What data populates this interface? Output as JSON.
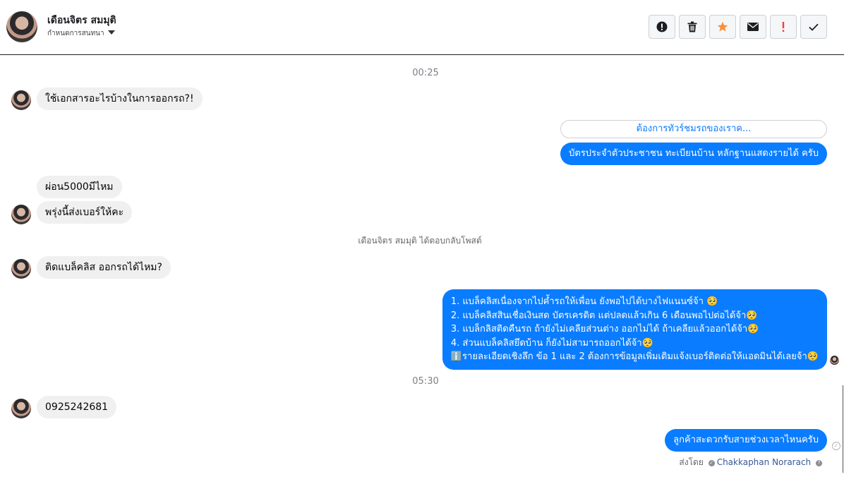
{
  "header": {
    "name": "เดือนจิตร สมมุติ",
    "subtitle": "กำหนดการสนทนา"
  },
  "toolbar": {
    "buttons": [
      {
        "icon": "info-circle-icon"
      },
      {
        "icon": "trash-icon"
      },
      {
        "icon": "star-icon",
        "color": "#f7923b"
      },
      {
        "icon": "envelope-icon"
      },
      {
        "icon": "exclamation-icon",
        "color": "#fa383e"
      },
      {
        "icon": "check-icon"
      }
    ]
  },
  "thread": {
    "time1": "00:25",
    "msg1": "ใช้เอกสารอะไรบ้างในการออกรถ?!",
    "quick_reply": "ต้องการทัวร์ชมรถของเราค...",
    "reply1": "บัตรประจำตัวประชาชน ทะเบียนบ้าน หลักฐานแสดงรายได้ ครับ",
    "msg2": "ผ่อน5000มีไหม",
    "msg3": "พรุ่งนี้ส่งเบอร์ให้คะ",
    "system_note": "เดือนจิตร สมมุติ ได้ตอบกลับโพสต์",
    "msg4": "ติดแบล็คลิส ออกรถได้ไหม?",
    "reply2": "1. แบล็คลิสเนื่องจากไปค้ำรถให้เพื่อน ยังพอไปได้บางไฟแนนซ์จ้า 🥺\n2. แบล็คลิสสินเชื่อเงินสด บัตรเครดิต แต่ปลดแล้วเกิน 6 เดือนพอไปต่อได้จ้า🥺\n3. แบล็กลิสติดคืนรถ ถ้ายังไม่เคลียส่วนต่าง ออกไม่ได้ ถ้าเคลียแล้วออกได้จ้า🥺\n4. ส่วนแบล็คลิสยึดบ้าน ก็ยังไม่สามารถออกได้จ้า🥺\nℹ️รายละเอียดเชิงลึก ข้อ 1 และ 2 ต้องการข้อมูลเพิ่มเติมแจ้งเบอร์ติดต่อให้แอดมินได้เลยจ้า🥺",
    "time2": "05:30",
    "msg5": "0925242681",
    "reply3": "ลูกค้าสะดวกรับสายช่วงเวลาไหนครับ",
    "sent_by_label": "ส่งโดย",
    "sent_by_agent": "Chakkaphan Norarach"
  }
}
